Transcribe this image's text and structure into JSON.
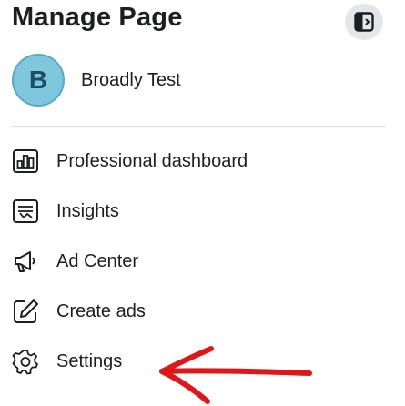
{
  "header": {
    "title": "Manage Page",
    "toggle_icon": "sidebar-toggle-icon"
  },
  "page": {
    "avatar_letter": "B",
    "name": "Broadly Test",
    "avatar_color": "#7ec7dd"
  },
  "menu": [
    {
      "label": "Professional dashboard",
      "icon": "dashboard-icon"
    },
    {
      "label": "Insights",
      "icon": "insights-icon"
    },
    {
      "label": "Ad Center",
      "icon": "megaphone-icon"
    },
    {
      "label": "Create ads",
      "icon": "pencil-icon"
    },
    {
      "label": "Settings",
      "icon": "gear-icon"
    }
  ],
  "annotation": {
    "arrow_color": "#e0161b",
    "points_to": "Settings"
  }
}
